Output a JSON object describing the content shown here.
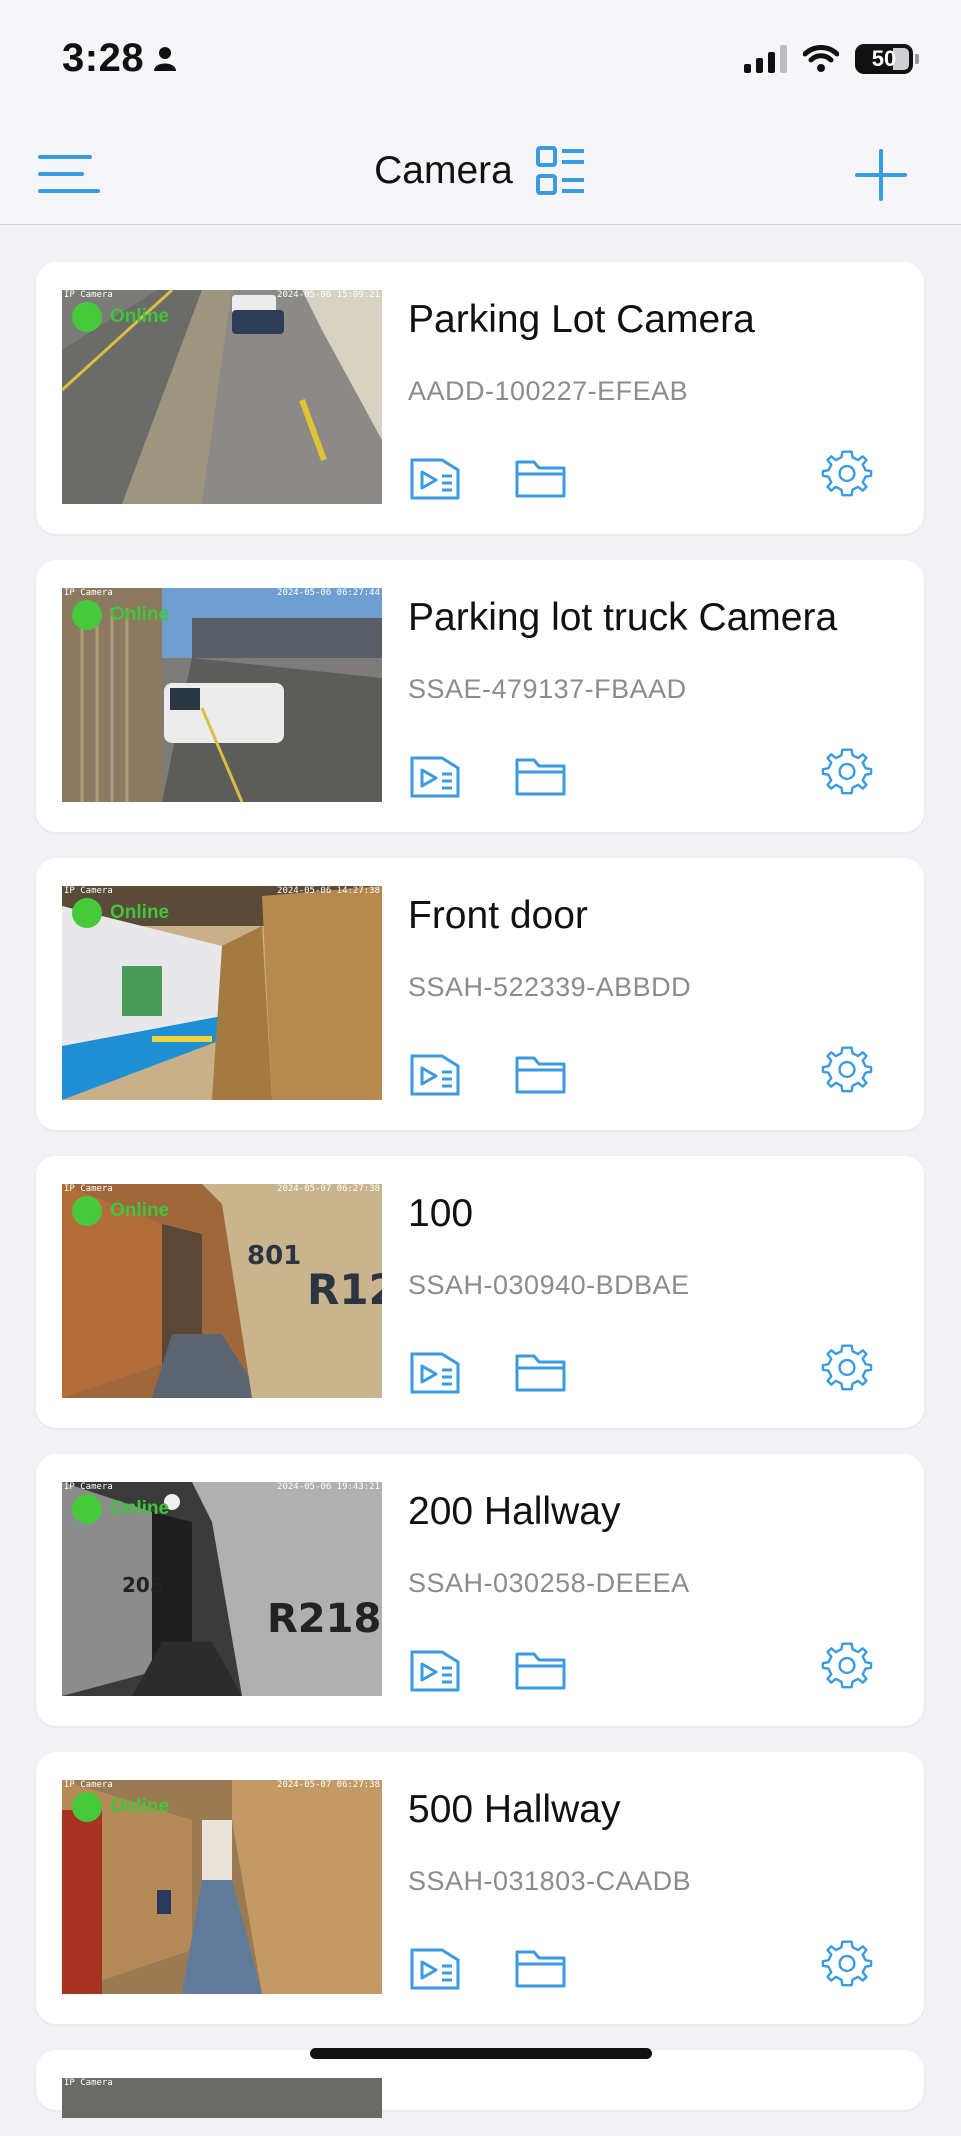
{
  "status_bar": {
    "time": "3:28",
    "battery": "50"
  },
  "nav": {
    "title": "Camera"
  },
  "colors": {
    "accent": "#3a9be0",
    "online": "#46c93a"
  },
  "cameras": [
    {
      "name": "Parking Lot Camera",
      "id": "AADD-100227-EFEAB",
      "status": "Online",
      "label": "IP Camera",
      "timestamp": "2024-05-06 15:09:21"
    },
    {
      "name": "Parking lot truck Camera",
      "id": "SSAE-479137-FBAAD",
      "status": "Online",
      "label": "IP Camera",
      "timestamp": "2024-05-06 06:27:44"
    },
    {
      "name": "Front door",
      "id": "SSAH-522339-ABBDD",
      "status": "Online",
      "label": "IP Camera",
      "timestamp": "2024-05-06 14:27:38"
    },
    {
      "name": "100",
      "id": "SSAH-030940-BDBAE",
      "status": "Online",
      "label": "IP Camera",
      "timestamp": "2024-05-07 06:27:38"
    },
    {
      "name": "200 Hallway",
      "id": "SSAH-030258-DEEEA",
      "status": "Online",
      "label": "IP Camera",
      "timestamp": "2024-05-06 19:43:21"
    },
    {
      "name": "500 Hallway",
      "id": "SSAH-031803-CAADB",
      "status": "Online",
      "label": "IP Camera",
      "timestamp": "2024-05-07 06:27:38"
    }
  ],
  "partial_card": {
    "label": "IP Camera"
  }
}
